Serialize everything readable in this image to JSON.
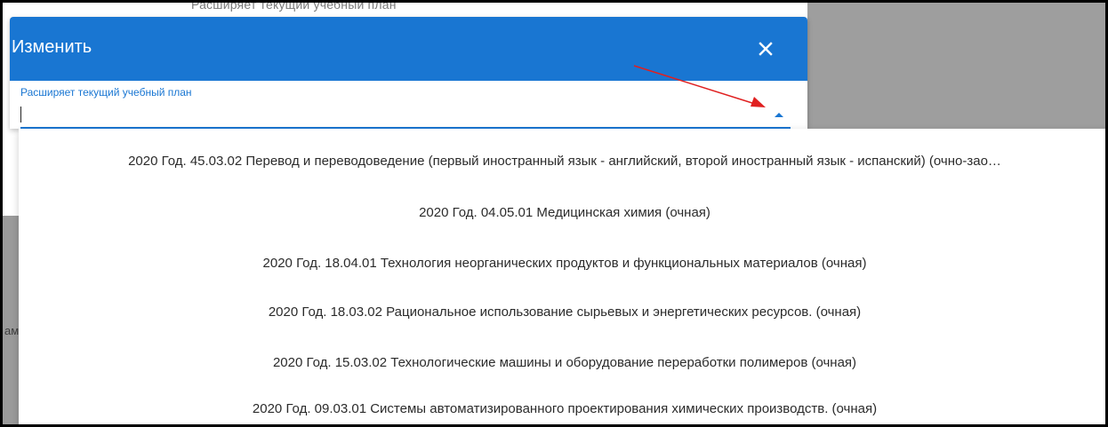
{
  "background": {
    "partial_text": "Расширяет текущий учебный план",
    "partial_letter": "ам"
  },
  "dialog": {
    "title": "Изменить",
    "close_icon": "close-icon",
    "field": {
      "label": "Расширяет текущий учебный план",
      "value": ""
    }
  },
  "menu": {
    "items": [
      "2020 Год. 45.03.02 Перевод и переводоведение (первый иностранный язык - английский, второй иностранный язык - испанский) (очно-зао…",
      "2020 Год. 04.05.01 Медицинская химия (очная)",
      "2020 Год. 18.04.01 Технология неорганических продуктов и функциональных материалов (очная)",
      "2020 Год. 18.03.02 Рациональное использование сырьевых и энергетических ресурсов. (очная)",
      "2020 Год. 15.03.02 Технологические машины и оборудование переработки полимеров (очная)",
      "2020 Год. 09.03.01 Системы автоматизированного проектирования химических производств. (очная)"
    ]
  },
  "colors": {
    "header": "#1976d2",
    "accent": "#1976d2",
    "annotation_arrow": "#e02020"
  }
}
